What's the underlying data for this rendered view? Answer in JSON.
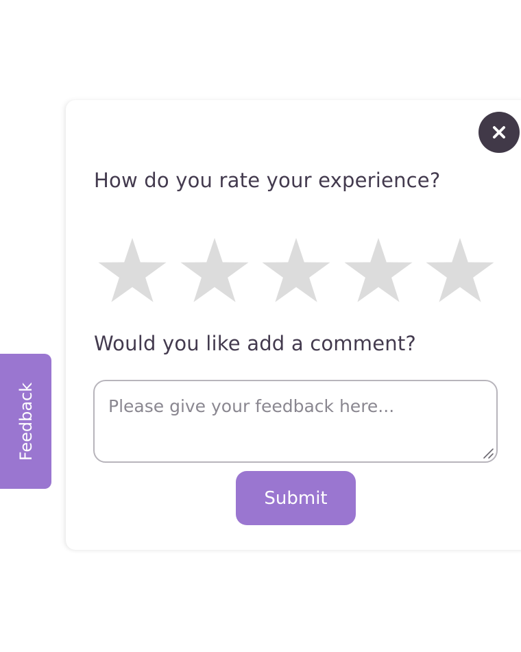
{
  "feedback_tab": {
    "label": "Feedback"
  },
  "dialog": {
    "close_icon": "close-icon",
    "rating_question": "How do you rate your experience?",
    "rating": {
      "value": 0,
      "max": 5,
      "star_icon": "star-icon"
    },
    "comment_question": "Would you like add a comment?",
    "comment_field": {
      "placeholder": "Please give your feedback here...",
      "value": ""
    },
    "submit_label": "Submit"
  },
  "colors": {
    "accent": "#9a76d0",
    "close_button_bg": "#413948",
    "text": "#433a4e",
    "star_empty": "#dcdcdc",
    "input_border": "#b7b4bb",
    "placeholder": "#8a8790"
  }
}
